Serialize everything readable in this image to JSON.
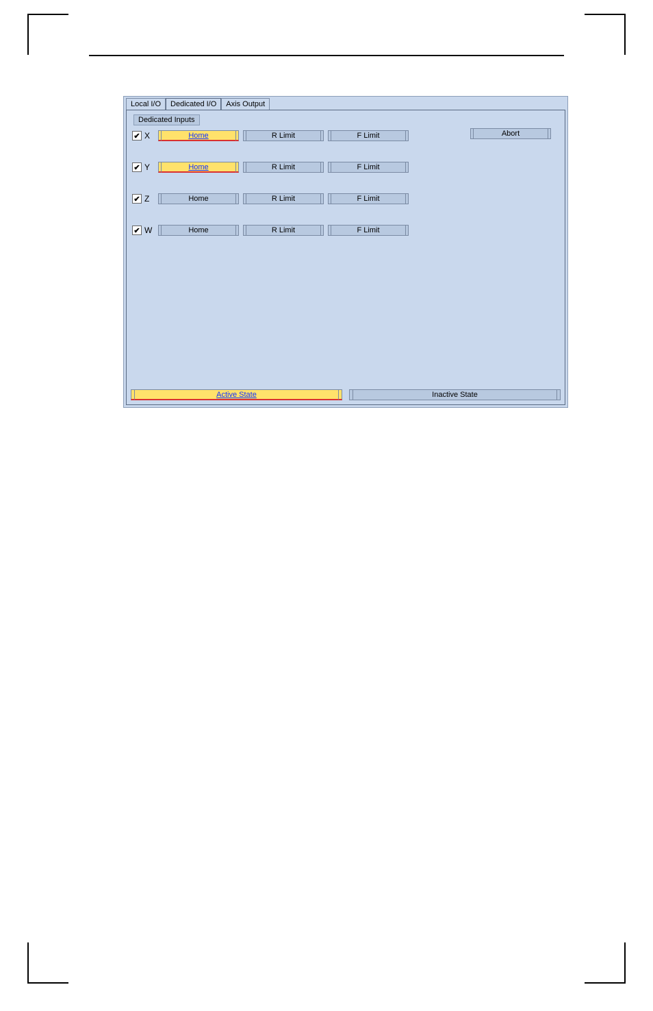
{
  "tabs": {
    "local_io": "Local I/O",
    "dedicated_io": "Dedicated I/O",
    "axis_output": "Axis Output"
  },
  "group": {
    "dedicated_inputs": "Dedicated Inputs"
  },
  "axes": [
    {
      "label": "X",
      "checked": true,
      "home": "Home",
      "home_active": true,
      "rlimit": "R Limit",
      "flimit": "F Limit"
    },
    {
      "label": "Y",
      "checked": true,
      "home": "Home",
      "home_active": true,
      "rlimit": "R Limit",
      "flimit": "F Limit"
    },
    {
      "label": "Z",
      "checked": true,
      "home": "Home",
      "home_active": false,
      "rlimit": "R Limit",
      "flimit": "F Limit"
    },
    {
      "label": "W",
      "checked": true,
      "home": "Home",
      "home_active": false,
      "rlimit": "R Limit",
      "flimit": "F Limit"
    }
  ],
  "abort": "Abort",
  "legend": {
    "active": "Active State",
    "inactive": "Inactive State"
  }
}
